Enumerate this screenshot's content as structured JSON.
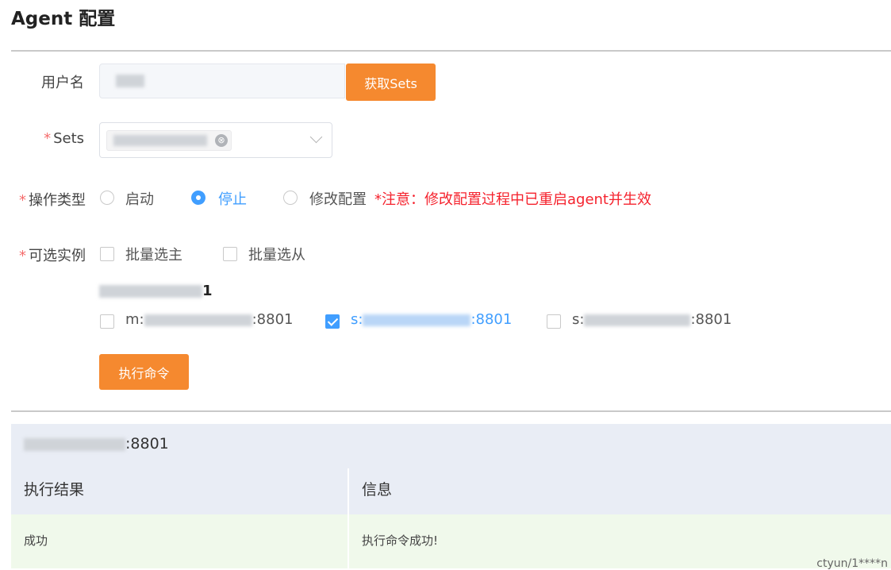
{
  "page": {
    "title": "Agent 配置"
  },
  "form": {
    "username_label": "用户名",
    "fetch_sets_button": "获取Sets",
    "required_mark": "*",
    "sets_label": "Sets",
    "sets_tag_close": "⊗",
    "op_type_label": "操作类型",
    "op_options": [
      {
        "label": "启动",
        "selected": false
      },
      {
        "label": "停止",
        "selected": true
      },
      {
        "label": "修改配置",
        "selected": false
      }
    ],
    "op_note": "*注意：修改配置过程中已重启agent并生效",
    "instances_label": "可选实例",
    "batch_master": "批量选主",
    "batch_slave": "批量选从",
    "group_suffix": "1",
    "instances": [
      {
        "prefix": "m:",
        "suffix": ":8801",
        "checked": false
      },
      {
        "prefix": "s:",
        "suffix": ":8801",
        "checked": true
      },
      {
        "prefix": "s:",
        "suffix": ":8801",
        "checked": false
      }
    ],
    "execute_button": "执行命令"
  },
  "result": {
    "host_suffix": ":8801",
    "columns": [
      "执行结果",
      "信息"
    ],
    "rows": [
      [
        "成功",
        "执行命令成功!"
      ]
    ]
  },
  "watermark": "ctyun/1****n",
  "colors": {
    "accent": "#f5892f",
    "primary": "#409eff",
    "danger": "#f5222d",
    "success_row": "#f0f9eb"
  }
}
